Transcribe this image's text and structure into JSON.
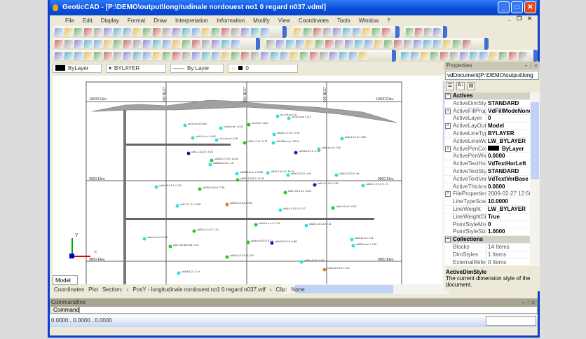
{
  "title": "GeoticCAD - [P:\\DEMO\\output\\longitudinale nordouest no1 0  regard n037.vdml]",
  "menu": [
    "File",
    "Edit",
    "Display",
    "Format",
    "Draw",
    "Interpretation",
    "Information",
    "Modify",
    "View",
    "Coordinates",
    "Tools",
    "Window",
    "?"
  ],
  "layerbar": {
    "color": "ByLayer",
    "linetype": "BYLAYER",
    "lineweight": "By Layer",
    "layer": "0"
  },
  "drawing": {
    "elev_labels": {
      "top_left": "10000 Élév.",
      "top_right": "10000 Élév.",
      "mid_left": "9900 Élév.",
      "mid_right": "9900 Élév.",
      "low_left": "9800 Élév.",
      "low_right": "9800 Élév."
    },
    "section_labels": [
      "200 N127",
      "300 N127",
      "400 N127"
    ],
    "point_colors": {
      "cyan": "#2ee0e0",
      "green": "#22cc22",
      "blue": "#1020a0",
      "orange": "#e08020"
    },
    "points": [
      {
        "label": "cd-10:xx.xx / 60x",
        "color": "cyan"
      },
      {
        "label": "cd-6:xx.xx / 11.02",
        "color": "cyan"
      },
      {
        "label": "cd-3:3.2 / 122x",
        "color": "green"
      },
      {
        "label": "cd-1:xx.xx / 10",
        "color": "cyan"
      },
      {
        "label": "cd-12:xx.xx / 11.2",
        "color": "cyan"
      },
      {
        "label": "cd-9:1.x 1.x / 6.43",
        "color": "cyan"
      },
      {
        "label": "cd-4:xx.xx / 6.36",
        "color": "cyan"
      },
      {
        "label": "cd22:x.7 x7 / 5.72",
        "color": "green"
      },
      {
        "label": "cd2x3:1.3 10 / 17.21",
        "color": "cyan"
      },
      {
        "label": "cd1426:xx.xx / 22.2x",
        "color": "cyan"
      },
      {
        "label": "cd3x:1.6 1.6 / 3.80",
        "color": "cyan"
      },
      {
        "label": "cd2x:xx.xx / 2.62",
        "color": "cyan"
      },
      {
        "label": "cd11-1:22.23 / 9.23",
        "color": "blue"
      },
      {
        "label": "cd2x6:2.12.1 / 1.28",
        "color": "blue"
      },
      {
        "label": "cd302:x.7 6.5 / 13.3x",
        "color": "green"
      },
      {
        "label": "cd1822:xx.xx / 1.6",
        "color": "cyan"
      },
      {
        "label": "cd1823:xx.xx / 10.60",
        "color": "cyan"
      },
      {
        "label": "cd2x1:1.8 1.8 / 16.13",
        "color": "cyan"
      },
      {
        "label": "cd2x:0.3 0.3 / x.2x",
        "color": "cyan"
      },
      {
        "label": "cd3x1:0.3 0.3 / 6x",
        "color": "cyan"
      },
      {
        "label": "cd231:1.8 8.2 / 11.28",
        "color": "green"
      },
      {
        "label": "cd2x:3.0 3.0 / 3.60",
        "color": "blue"
      },
      {
        "label": "cd1x1:0.1 0.1 / 2.03",
        "color": "cyan"
      },
      {
        "label": "cd203:x.8 6.8 / 7.81",
        "color": "green"
      },
      {
        "label": "cd3x1:1.9 1.9 / 1.71",
        "color": "cyan"
      },
      {
        "label": "cd27-1:5.3 5.3 / 3.03",
        "color": "green"
      },
      {
        "label": "cd17:2.1 3.1 / 3.81",
        "color": "cyan"
      },
      {
        "label": "cd2x2:6.6 6.6 / 0.00",
        "color": "orange"
      },
      {
        "label": "cd2x1:1.9 1.9 / 0.17",
        "color": "cyan"
      },
      {
        "label": "cd3x:3.3 x.3 / 6.02",
        "color": "green"
      },
      {
        "label": "cd2x2:x.x x.x / 7.87",
        "color": "green"
      },
      {
        "label": "cd322:1.8 1.8 / 2.x1",
        "color": "cyan"
      },
      {
        "label": "cd33x:x.2 x.2 / 2.2x",
        "color": "green"
      },
      {
        "label": "cd1x2:xx.xx / 6.26",
        "color": "cyan"
      },
      {
        "label": "cd17-3:3.36 3.36 / 1.xx",
        "color": "green"
      },
      {
        "label": "cd2xx:x.6 5.3 / 5.33",
        "color": "green"
      },
      {
        "label": "cd2x3:2.8 2.8 / x.86",
        "color": "blue"
      },
      {
        "label": "cd3x:xx.xx / 2.21",
        "color": "cyan"
      },
      {
        "label": "cd302:xx.xx / 2.49",
        "color": "cyan"
      },
      {
        "label": "cd2x3:3.2 3.6 / 13.19",
        "color": "green"
      },
      {
        "label": "cd32x:3.x 0 / 3.49",
        "color": "cyan"
      },
      {
        "label": "cd2x6:1.2 1.2 / x",
        "color": "cyan"
      },
      {
        "label": "cd2x3:4.2 5.2 / 3.21",
        "color": "orange"
      }
    ]
  },
  "model_tab": "Model",
  "status": {
    "coordinates": "Coordinates",
    "plot": "Plot",
    "section": "Section:",
    "section_value": "PosY - longitudinale nordouest no1 0  regard n037.vdf",
    "clip": "Clip:",
    "clip_value": "None"
  },
  "properties": {
    "title": "Properties",
    "selector": "vdDocument[P:\\DEMO\\output\\long",
    "rows": [
      {
        "cat": "Actives"
      },
      {
        "k": "ActiveDimStyle",
        "v": "STANDARD"
      },
      {
        "k": "ActiveFillProperties",
        "v": "VdFillModeNone",
        "exp": true
      },
      {
        "k": "ActiveLayer",
        "v": "0"
      },
      {
        "k": "ActiveLayOut",
        "v": "Model",
        "exp": true
      },
      {
        "k": "ActiveLineType",
        "v": "BYLAYER"
      },
      {
        "k": "ActiveLineWeight",
        "v": "LW_BYLAYER"
      },
      {
        "k": "ActivePenColor",
        "v": "ByLayer",
        "exp": true,
        "swatch": true
      },
      {
        "k": "ActivePenWidth",
        "v": "0.0000"
      },
      {
        "k": "ActiveTextHorJust",
        "v": "VdTextHorLeft"
      },
      {
        "k": "ActiveTextStyle",
        "v": "STANDARD"
      },
      {
        "k": "ActiveTextVerJust",
        "v": "VdTextVerBase"
      },
      {
        "k": "ActiveThickness",
        "v": "0.0000"
      },
      {
        "k": "FileProperties",
        "v": "2009-02-27 12:56",
        "exp": true,
        "normal": true
      },
      {
        "k": "LineTypeScale",
        "v": "10.0000"
      },
      {
        "k": "LineWeight",
        "v": "LW_BYLAYER"
      },
      {
        "k": "LineWeightDisplay",
        "v": "True"
      },
      {
        "k": "PointStyleMode",
        "v": "0"
      },
      {
        "k": "PointStyleSize",
        "v": "1.0000"
      },
      {
        "cat": "Collections"
      },
      {
        "k": "Blocks",
        "v": "14 Items",
        "normal": true
      },
      {
        "k": "DimStyles",
        "v": "1 Items",
        "normal": true
      },
      {
        "k": "ExternalReferences",
        "v": "0 Items",
        "normal": true
      }
    ],
    "desc_title": "ActiveDimStyle",
    "desc_text": "The current dimension style of the document."
  },
  "commandline": {
    "title": "Commandline",
    "label": "Command",
    "coords": "0.0000 , 0.0000 , 0.0000"
  }
}
